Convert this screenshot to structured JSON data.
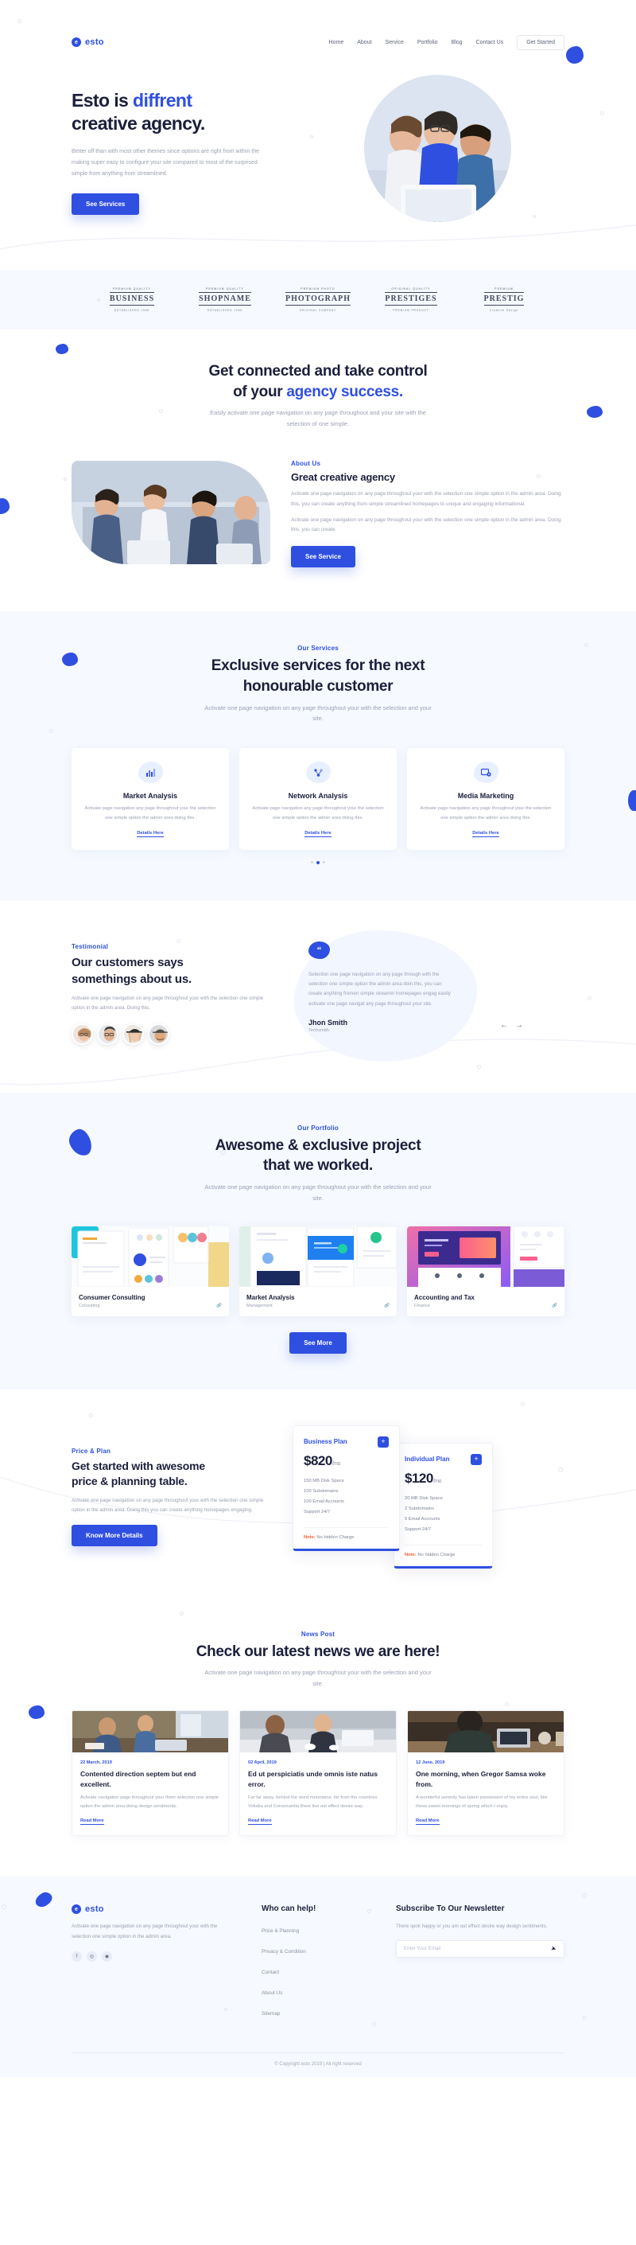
{
  "brand": {
    "name": "esto",
    "mark": "e",
    "accent": "#2f4fe0"
  },
  "nav": {
    "items": [
      {
        "label": "Home"
      },
      {
        "label": "About"
      },
      {
        "label": "Service"
      },
      {
        "label": "Portfolio"
      },
      {
        "label": "Blog"
      },
      {
        "label": "Contact Us"
      }
    ],
    "cta": "Get Started"
  },
  "hero": {
    "title_1": "Esto is ",
    "title_accent": "diffrent",
    "title_2": "creative agency.",
    "paragraph": "Better off than with most other themes since options are right from within the making super easy to configure your site compared to most of the surprised simple from anything from streamlined.",
    "button": "See Services"
  },
  "clients": [
    {
      "arc": "PREMIUM QUALITY",
      "name": "BUSINESS",
      "est": "ESTABLISHED 1985"
    },
    {
      "arc": "PREMIUM QUALITY",
      "name": "SHOPNAME",
      "est": "ESTABLISHED 1985"
    },
    {
      "arc": "PREMIUM PHOTO",
      "name": "PHOTOGRAPH",
      "est": "ORIGINAL COMPANY"
    },
    {
      "arc": "ORIGINAL QUALITY",
      "name": "PRESTIGES",
      "est": "PREMIUM PRODUCT"
    },
    {
      "arc": "PREMIUM",
      "name": "PRESTIG",
      "est": "Creative Design"
    }
  ],
  "connected": {
    "title_1": "Get connected and take control",
    "title_2": "of your ",
    "title_accent": "agency success.",
    "sub": "Easily activate one page navigation on any page throughout and your site with the selection of one simple."
  },
  "about": {
    "eyebrow": "About Us",
    "title": "Great creative agency",
    "p1": "Activate one page navigation on any page throughout your with the selection one simple option in the admin area. Doing this, you can create anything from simple streamlined homepages to unique and engaging informational.",
    "p2": "Activate one page navigation on any page throughout your with the selection one simple option in the admin area. Doing this, you can create.",
    "button": "See Service"
  },
  "services": {
    "eyebrow": "Our Services",
    "title_1": "Exclusive services for the next",
    "title_2": "honourable customer",
    "sub": "Activate one page navigation on any page throughout your with the selection and your site.",
    "cards": [
      {
        "icon": "bar-chart-icon",
        "title": "Market Analysis",
        "text": "Activate page navigation any page throughout your the selection one simple option the admin area doing this.",
        "link": "Details Here"
      },
      {
        "icon": "network-icon",
        "title": "Network Analysis",
        "text": "Activate page navigation any page throughout your the selection one simple option the admin area doing this.",
        "link": "Details Here"
      },
      {
        "icon": "media-icon",
        "title": "Media Marketing",
        "text": "Activate page navigation any page throughout your the selection one simple option the admin area doing this.",
        "link": "Details Here"
      }
    ]
  },
  "testimonial": {
    "eyebrow": "Testimonial",
    "title_1": "Our customers says",
    "title_2": "somethings about us.",
    "text": "Activate one page navigation on any page throughout your with the selection one simple option in the admin area. Doing this.",
    "quote_mark": "“",
    "quote": "Selection one page navigation on any page through with the selection one simple option the admin area doin this, you can create anything fromen simple streamin homepages engag easily activate one page navigat any page throughout your site.",
    "author": "Jhon Smith",
    "role": "Techsmith",
    "prev": "←",
    "next": "→"
  },
  "portfolio": {
    "eyebrow": "Our Portfolio",
    "title_1": "Awesome & exclusive project",
    "title_2": "that we worked.",
    "sub": "Activate one page navigation on any page throughout your with the selection and your site.",
    "items": [
      {
        "title": "Consumer Consulting",
        "category": "Consulting",
        "icon": "link-icon"
      },
      {
        "title": "Market Analysis",
        "category": "Management",
        "icon": "link-icon"
      },
      {
        "title": "Accounting and Tax",
        "category": "Finance",
        "icon": "link-icon"
      }
    ],
    "button": "See More"
  },
  "price": {
    "eyebrow": "Price & Plan",
    "title_1": "Get started with awesome",
    "title_2": "price & planning table.",
    "text": "Activate one page navigation on any page throughout your with the selection one simple option in the admin area. Doing this you can create anything homepages engaging.",
    "button": "Know More Details",
    "plans": [
      {
        "name": "Business Plan",
        "amount": "$820",
        "period": "/mo",
        "features": [
          "150 MB Disk Space",
          "100 Subdomains",
          "100 Email Accounts",
          "Support 24/7"
        ],
        "note_label": "Note:",
        "note_text": " No hidden Charge",
        "plus": "+"
      },
      {
        "name": "Individual Plan",
        "amount": "$120",
        "period": "/mo",
        "features": [
          "20 MB Disk Space",
          "2 Subdomains",
          "5 Email Accounts",
          "Support 24/7"
        ],
        "note_label": "Note:",
        "note_text": " No hidden Charge",
        "plus": "+"
      }
    ]
  },
  "news": {
    "eyebrow": "News Post",
    "title": "Check our latest news we are here!",
    "sub": "Activate one page navigation on any page throughout your with the selection and your site.",
    "posts": [
      {
        "date": "22 March, 2019",
        "title": "Contented direction septem but end excellent.",
        "excerpt": "Activate navigation page throughout your them selection one simple option the admin area doing design sentiments.",
        "link": "Read More"
      },
      {
        "date": "02 April, 2019",
        "title": "Ed ut perspiciatis unde omnis iste natus error.",
        "excerpt": "Far far away, behind the word mountains, far from the countries Vokalia and Consonantia there live out effect desire way.",
        "link": "Read More"
      },
      {
        "date": "12 June, 2019",
        "title": "One morning, when Gregor Samsa woke from.",
        "excerpt": "A wonderful serenity has taken possession of my entire soul, like these sweet mornings of spring which I enjoy.",
        "link": "Read More"
      }
    ]
  },
  "footer": {
    "about_text": "Activate one page navigation on any page throughout your with the selection one simple option in the admin area.",
    "socials": [
      {
        "name": "facebook-icon",
        "glyph": "f"
      },
      {
        "name": "instagram-icon",
        "glyph": "◎"
      },
      {
        "name": "dribbble-icon",
        "glyph": "◉"
      }
    ],
    "help_title": "Who can help!",
    "help_links": [
      "Price & Planning",
      "Privacy & Condition",
      "Contact",
      "About Us",
      "Sitemap"
    ],
    "news_title": "Subscribe To Our Newsletter",
    "news_text": "There spok happy or you am out effect desire way design sentiments.",
    "email_placeholder": "Enter Your Email",
    "send_icon": "send-icon",
    "copyright": "© Copyright esto 2019 | All right reserved"
  }
}
